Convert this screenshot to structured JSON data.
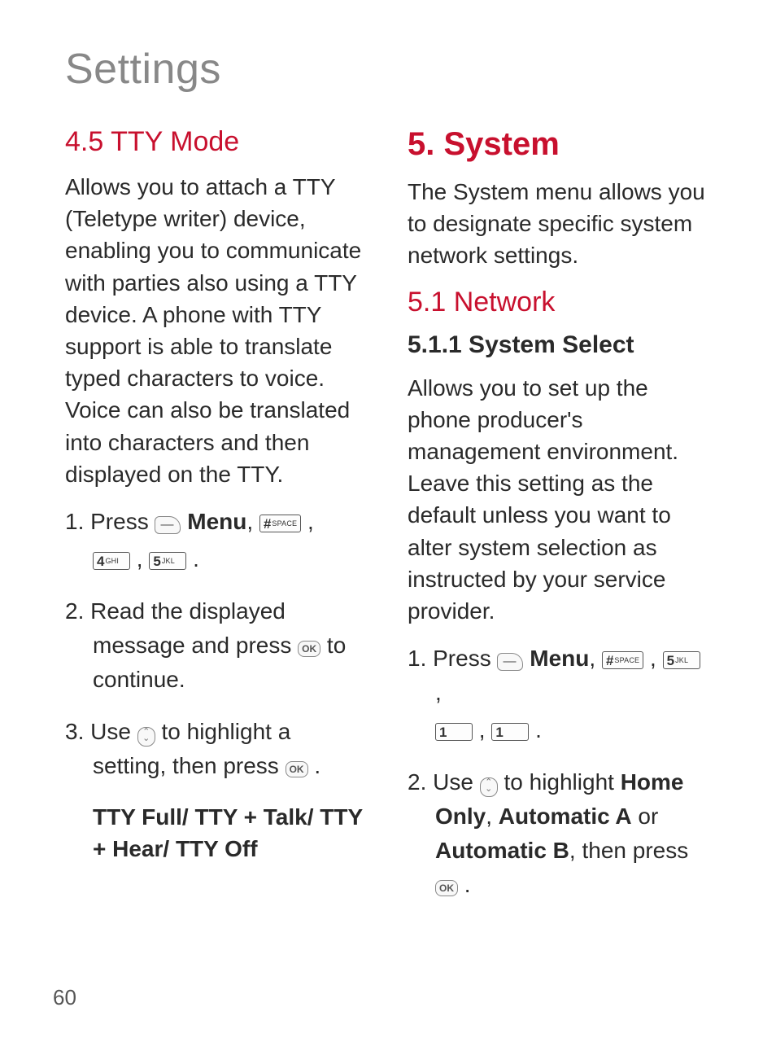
{
  "page_title": "Settings",
  "page_number": "60",
  "left": {
    "h1": "4.5 TTY Mode",
    "intro": "Allows you to attach a TTY (Teletype writer) device, enabling you to communicate with parties also using a TTY device. A phone with TTY support is able to translate typed characters to voice. Voice can also be translated into characters and then displayed on the TTY.",
    "step1_a": "1. Press ",
    "step1_menu": "Menu",
    "step1_b": ", ",
    "step1_c": " ,",
    "step1_d": " , ",
    "step1_e": " .",
    "step2_a": "2. Read the displayed message and press ",
    "step2_b": " to continue.",
    "step3_a": "3. Use ",
    "step3_b": " to highlight a setting, then press ",
    "step3_c": " .",
    "options": "TTY Full/ TTY + Talk/ TTY + Hear/ TTY Off"
  },
  "right": {
    "h1": "5. System",
    "intro": "The System menu allows you to designate specific system network settings.",
    "h2": "5.1 Network",
    "h3": "5.1.1 System Select",
    "body": "Allows you to set up the phone producer's management environment. Leave this setting as the default unless you want to alter system selection as instructed by your service provider.",
    "step1_a": "1. Press ",
    "step1_menu": "Menu",
    "step1_b": ", ",
    "step1_c": " , ",
    "step1_d": " ,",
    "step1_e": " , ",
    "step1_f": " .",
    "step2_a": "2. Use ",
    "step2_b": " to highlight ",
    "step2_opt1": "Home Only",
    "step2_sep1": ", ",
    "step2_opt2": "Automatic A",
    "step2_sep2": " or ",
    "step2_opt3": "Automatic B",
    "step2_c": ", then press ",
    "step2_d": " ."
  },
  "keys": {
    "hash_big": "#",
    "hash_small": "SPACE",
    "k4_big": "4",
    "k4_small": "GHI",
    "k5_big": "5",
    "k5_small": "JKL",
    "k1_big": "1",
    "k1_small": "",
    "soft": "—",
    "ok": "OK"
  }
}
